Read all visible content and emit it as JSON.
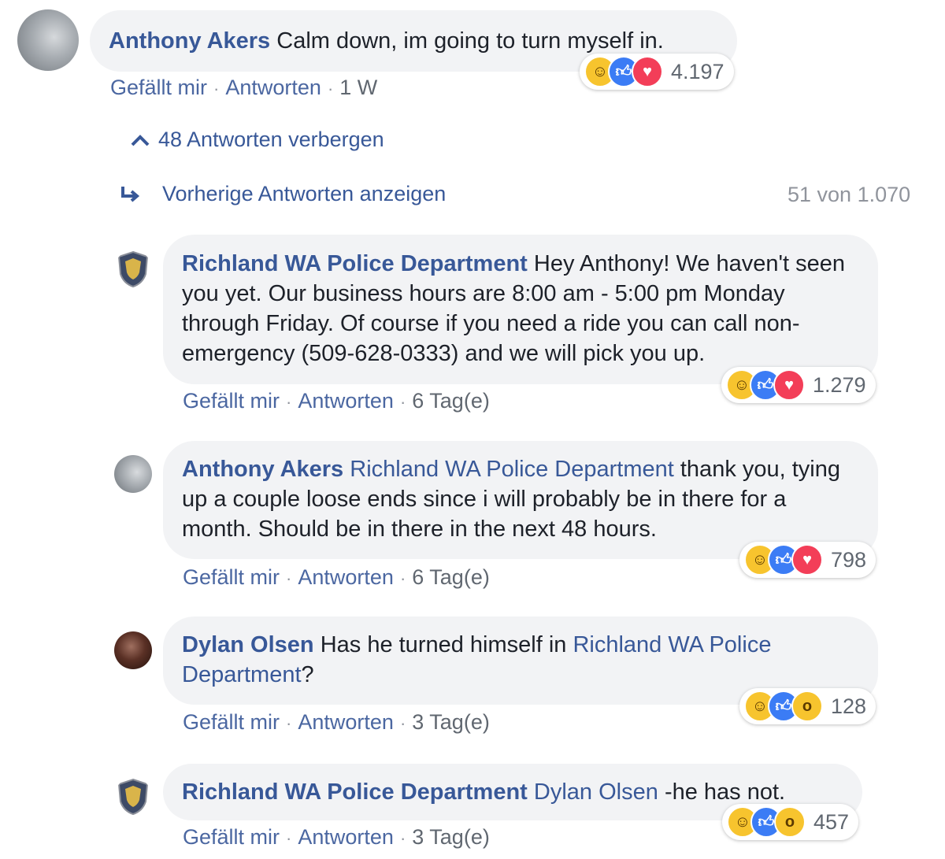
{
  "top_comment": {
    "author": "Anthony Akers",
    "text": "Calm down, im going to turn myself in.",
    "like_label": "Gefällt mir",
    "reply_label": "Antworten",
    "time": "1 W",
    "reaction_count": "4.197",
    "reactions": [
      "haha-icon",
      "like-icon",
      "love-icon"
    ]
  },
  "hide_replies": {
    "label": "48 Antworten verbergen"
  },
  "previous_replies": {
    "label": "Vorherige Antworten anzeigen",
    "counter": "51 von 1.070"
  },
  "replies": [
    {
      "author": "Richland WA Police Department",
      "mention": "",
      "text": "Hey Anthony! We haven't seen you yet. Our business hours are 8:00 am - 5:00 pm Monday through Friday. Of course if you need a ride you can call non-emergency (509-628-0333) and we will pick you up.",
      "suffix": "",
      "like_label": "Gefällt mir",
      "reply_label": "Antworten",
      "time": "6 Tag(e)",
      "reaction_count": "1.279",
      "reactions": [
        "haha-icon",
        "like-icon",
        "love-icon"
      ]
    },
    {
      "author": "Anthony Akers",
      "mention": "Richland WA Police Department",
      "text": "thank you, tying up a couple loose ends since i will probably be in there for a month. Should be in there in the next 48 hours.",
      "suffix": "",
      "like_label": "Gefällt mir",
      "reply_label": "Antworten",
      "time": "6 Tag(e)",
      "reaction_count": "798",
      "reactions": [
        "haha-icon",
        "like-icon",
        "love-icon"
      ]
    },
    {
      "author": "Dylan Olsen",
      "mention": "Richland WA Police Department",
      "text": "Has he turned himself in",
      "suffix": "?",
      "like_label": "Gefällt mir",
      "reply_label": "Antworten",
      "time": "3 Tag(e)",
      "reaction_count": "128",
      "reactions": [
        "haha-icon",
        "like-icon",
        "wow-icon"
      ]
    },
    {
      "author": "Richland WA Police Department",
      "mention": "Dylan Olsen",
      "text": "-he has not.",
      "suffix": "",
      "like_label": "Gefällt mir",
      "reply_label": "Antworten",
      "time": "3 Tag(e)",
      "reaction_count": "457",
      "reactions": [
        "haha-icon",
        "like-icon",
        "wow-icon"
      ]
    }
  ],
  "colors": {
    "link": "#385898",
    "bubble": "#f2f3f5",
    "meta": "#606770"
  }
}
